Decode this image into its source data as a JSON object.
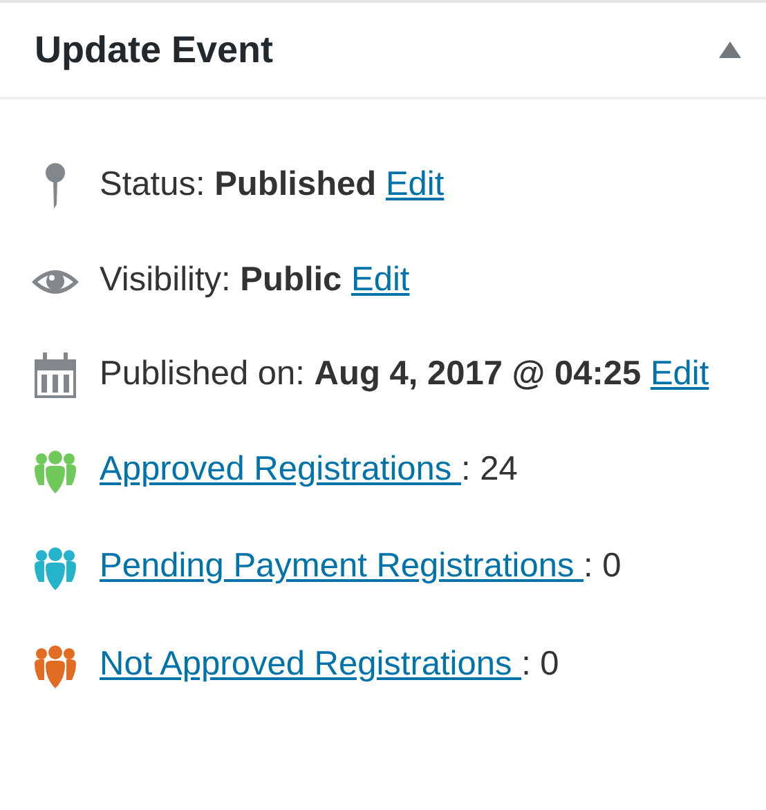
{
  "panel": {
    "title": "Update Event",
    "expanded": true
  },
  "meta": [
    {
      "kind": "pin",
      "label": "Status:",
      "value": "Published",
      "link": "Edit"
    },
    {
      "kind": "eye",
      "label": "Visibility:",
      "value": "Public",
      "link": "Edit"
    },
    {
      "kind": "calendar",
      "label": "Published on:",
      "value": "Aug 4, 2017 @ 04:25",
      "link": "Edit"
    }
  ],
  "registrations": [
    {
      "link": "Approved Registrations ",
      "count": ": 24",
      "color": "#6fc95b"
    },
    {
      "link": "Pending Payment Registrations ",
      "count": ": 0",
      "color": "#25b2cb"
    },
    {
      "link": "Not Approved Registrations ",
      "count": ": 0",
      "color": "#e36c24"
    }
  ]
}
